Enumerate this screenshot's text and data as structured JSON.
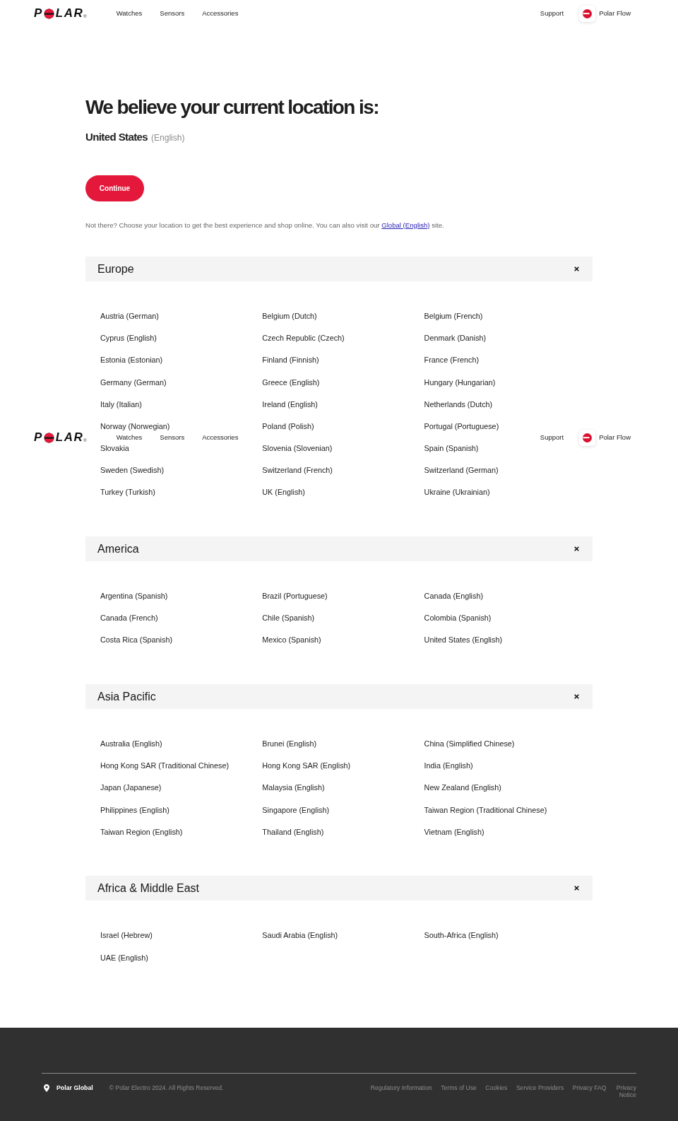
{
  "header": {
    "logo": {
      "start": "P",
      "end": "LAR",
      "mark": "®"
    },
    "nav": [
      "Watches",
      "Sensors",
      "Accessories"
    ],
    "support": "Support",
    "app_link": "Polar Flow"
  },
  "location": {
    "title": "We believe your current location is:",
    "country": "United States",
    "language": "(English)",
    "button": "Continue",
    "note": {
      "before": "Not there? Choose your location to get the best experience and shop online. You can also visit our",
      "link": "Global (English)",
      "after": "site."
    }
  },
  "regions": [
    {
      "name": "Europe",
      "expanded": true,
      "countries": [
        "Austria (German)",
        "Belgium (Dutch)",
        "Belgium (French)",
        "Cyprus (English)",
        "Czech Republic (Czech)",
        "Denmark (Danish)",
        "Estonia (Estonian)",
        "Finland (Finnish)",
        "France (French)",
        "Germany (German)",
        "Greece (English)",
        "Hungary (Hungarian)",
        "Italy (Italian)",
        "Ireland (English)",
        "Netherlands (Dutch)",
        "Norway (Norwegian)",
        "Poland (Polish)",
        "Portugal (Portuguese)",
        "Slovakia",
        "Slovenia (Slovenian)",
        "Spain (Spanish)",
        "Sweden (Swedish)",
        "Switzerland (French)",
        "Switzerland (German)",
        "Turkey (Turkish)",
        "UK (English)",
        "Ukraine (Ukrainian)"
      ]
    },
    {
      "name": "America",
      "expanded": true,
      "countries": [
        "Argentina (Spanish)",
        "Brazil (Portuguese)",
        "Canada (English)",
        "Canada (French)",
        "Chile (Spanish)",
        "Colombia (Spanish)",
        "Costa Rica (Spanish)",
        "Mexico (Spanish)",
        "United States (English)"
      ]
    },
    {
      "name": "Asia Pacific",
      "expanded": true,
      "countries": [
        "Australia (English)",
        "Brunei (English)",
        "China (Simplified Chinese)",
        "Hong Kong SAR (Traditional Chinese)",
        "Hong Kong SAR (English)",
        "India (English)",
        "Japan (Japanese)",
        "Malaysia (English)",
        "New Zealand (English)",
        "Philippines (English)",
        "Singapore (English)",
        "Taiwan Region (Traditional Chinese)",
        "Taiwan Region (English)",
        "Thailand (English)",
        "Vietnam (English)"
      ]
    },
    {
      "name": "Africa & Middle East",
      "expanded": true,
      "countries": [
        "Israel (Hebrew)",
        "Saudi Arabia (English)",
        "South-Africa (English)",
        "UAE (English)"
      ]
    }
  ],
  "sticky_header": {
    "logo": {
      "start": "P",
      "end": "LAR",
      "mark": "®"
    },
    "nav": [
      "Watches",
      "Sensors",
      "Accessories"
    ],
    "support": "Support",
    "app_link": "Polar Flow"
  },
  "footer": {
    "locale": "Polar Global",
    "copyright": "© Polar Electro 2024. All Rights Reserved.",
    "links": [
      "Regulatory Information",
      "Terms of Use",
      "Cookies",
      "Service Providers",
      "Privacy FAQ",
      "Privacy Notice"
    ]
  }
}
